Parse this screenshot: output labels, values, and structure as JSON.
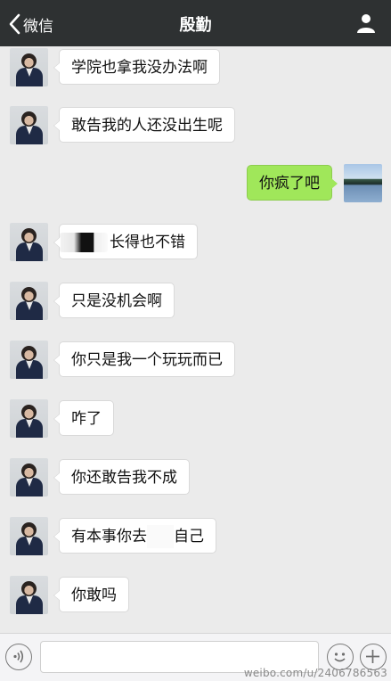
{
  "header": {
    "back_label": "微信",
    "title": "殷勤",
    "profile_icon": "person-icon"
  },
  "messages": [
    {
      "side": "left",
      "text": "学院也拿我没办法啊"
    },
    {
      "side": "left",
      "text": "敢告我的人还没出生呢"
    },
    {
      "side": "right",
      "text": "你疯了吧"
    },
    {
      "side": "left",
      "text": "长得也不错",
      "redacted_prefix": true
    },
    {
      "side": "left",
      "text": "只是没机会啊"
    },
    {
      "side": "left",
      "text": "你只是我一个玩玩而已"
    },
    {
      "side": "left",
      "text": "咋了"
    },
    {
      "side": "left",
      "text": "你还敢告我不成"
    },
    {
      "side": "left",
      "text_before": "有本事你去",
      "text_after": "自己",
      "redacted_middle": true
    },
    {
      "side": "left",
      "text": "你敢吗"
    }
  ],
  "input_bar": {
    "value": "",
    "voice_icon": "voice-icon",
    "emoji_icon": "emoji-icon",
    "plus_icon": "plus-icon"
  },
  "watermark": "weibo.com/u/2406786563"
}
